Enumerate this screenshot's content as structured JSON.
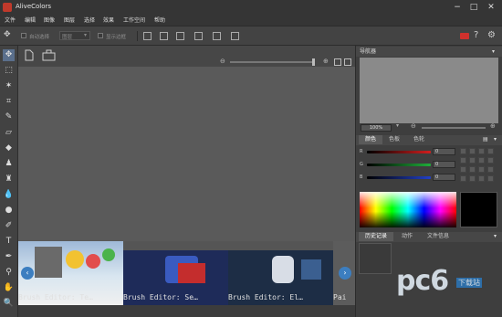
{
  "app": {
    "title": "AliveColors"
  },
  "window": {
    "min": "−",
    "max": "□",
    "close": "✕"
  },
  "menu": [
    "文件",
    "编辑",
    "图像",
    "图层",
    "选择",
    "效果",
    "工作空间",
    "帮助"
  ],
  "toolbar": {
    "autoselect": "自动选择",
    "layer_select": "图层",
    "show_bounds": "显示边框"
  },
  "tools": [
    {
      "name": "move-tool-icon",
      "glyph": "✥"
    },
    {
      "name": "marquee-tool-icon",
      "glyph": "⬚"
    },
    {
      "name": "magic-wand-icon",
      "glyph": "✶"
    },
    {
      "name": "crop-tool-icon",
      "glyph": "⌗"
    },
    {
      "name": "brush-tool-icon",
      "glyph": "✎"
    },
    {
      "name": "eraser-tool-icon",
      "glyph": "▱"
    },
    {
      "name": "fill-tool-icon",
      "glyph": "◆"
    },
    {
      "name": "stamp-tool-icon",
      "glyph": "♟"
    },
    {
      "name": "clone-tool-icon",
      "glyph": "♜"
    },
    {
      "name": "blur-tool-icon",
      "glyph": "💧"
    },
    {
      "name": "dodge-tool-icon",
      "glyph": "●"
    },
    {
      "name": "pencil-tool-icon",
      "glyph": "✐"
    },
    {
      "name": "text-tool-icon",
      "glyph": "T"
    },
    {
      "name": "pen-tool-icon",
      "glyph": "✒"
    },
    {
      "name": "eyedropper-tool-icon",
      "glyph": "⚲"
    },
    {
      "name": "hand-tool-icon",
      "glyph": "✋"
    },
    {
      "name": "zoom-tool-icon",
      "glyph": "🔍"
    }
  ],
  "filmstrip": {
    "items": [
      {
        "caption": "Brush Editor: Te…"
      },
      {
        "caption": "Brush Editor: Se…"
      },
      {
        "caption": "Brush Editor: El…"
      },
      {
        "caption": "Pai"
      }
    ],
    "prev": "‹",
    "next": "›"
  },
  "navigator": {
    "title": "导航器",
    "zoom": "100%"
  },
  "colors": {
    "tabs": [
      "颜色",
      "色板",
      "色轮"
    ],
    "channels": [
      {
        "label": "R",
        "value": "0",
        "color": "#d21e1e"
      },
      {
        "label": "G",
        "value": "0",
        "color": "#1fae3a"
      },
      {
        "label": "B",
        "value": "0",
        "color": "#2240c8"
      }
    ]
  },
  "history": {
    "tabs": [
      "历史记录",
      "动作",
      "文件信息"
    ]
  },
  "watermark": {
    "brand": "pc6",
    "sub": "下载站"
  }
}
